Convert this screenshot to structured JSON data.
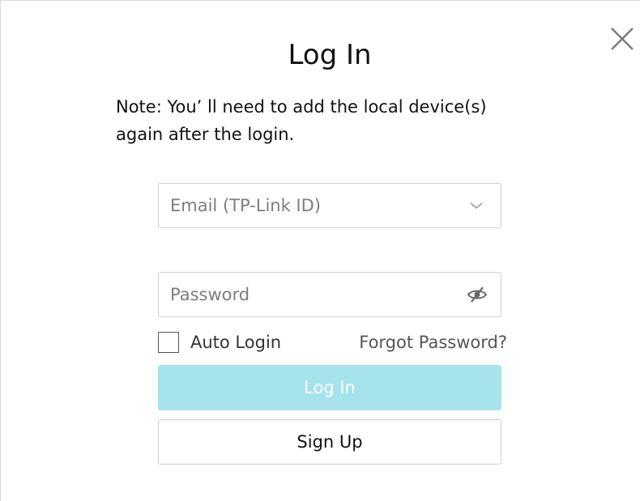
{
  "dialog": {
    "title": "Log In",
    "note": "Note:  You’ ll need to add the local device(s) again after the login."
  },
  "email": {
    "placeholder": "Email (TP-Link ID)",
    "dropdown_icon": "chevron-down-icon"
  },
  "password": {
    "placeholder": "Password",
    "visibility_icon": "eye-slash-icon"
  },
  "auto_login": {
    "label": "Auto Login",
    "checked": false
  },
  "forgot_password": "Forgot Password?",
  "buttons": {
    "login": "Log In",
    "signup": "Sign Up"
  },
  "colors": {
    "login_button_bg": "#a6e3ea",
    "border": "#cfcfcf"
  }
}
